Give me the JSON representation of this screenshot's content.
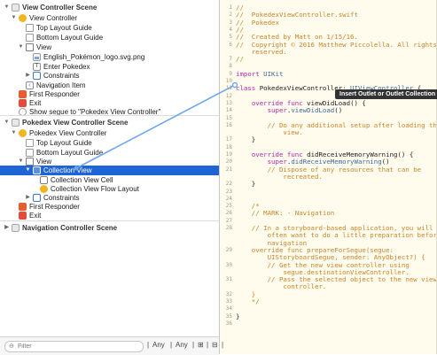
{
  "outline": {
    "items": [
      {
        "label": "View Controller Scene",
        "icon": "scene-icon",
        "level": 0,
        "tri": "▼",
        "kind": "hdr"
      },
      {
        "label": "View Controller",
        "icon": "view-controller-icon",
        "level": 1,
        "tri": "▼"
      },
      {
        "label": "Top Layout Guide",
        "icon": "layout-guide-icon",
        "level": 2,
        "tri": ""
      },
      {
        "label": "Bottom Layout Guide",
        "icon": "layout-guide-icon",
        "level": 2,
        "tri": ""
      },
      {
        "label": "View",
        "icon": "view-icon",
        "level": 2,
        "tri": "▼"
      },
      {
        "label": "English_Pokémon_logo.svg.png",
        "icon": "image-view-icon",
        "level": 3,
        "tri": ""
      },
      {
        "label": "Enter Pokedex",
        "icon": "text-field-icon",
        "level": 3,
        "tri": ""
      },
      {
        "label": "Constraints",
        "icon": "constraints-icon",
        "level": 3,
        "tri": "▶"
      },
      {
        "label": "Navigation Item",
        "icon": "navigation-item-icon",
        "level": 2,
        "tri": ""
      },
      {
        "label": "First Responder",
        "icon": "first-responder-icon",
        "level": 1,
        "tri": ""
      },
      {
        "label": "Exit",
        "icon": "exit-icon",
        "level": 1,
        "tri": ""
      },
      {
        "label": "Show segue to \"Pokedex View Controller\"",
        "icon": "segue-icon",
        "level": 1,
        "tri": ""
      },
      {
        "label": "Pokedex View Controller Scene",
        "icon": "scene-icon",
        "level": 0,
        "tri": "▼",
        "kind": "hdr"
      },
      {
        "label": "Pokedex View Controller",
        "icon": "view-controller-icon",
        "level": 1,
        "tri": "▼"
      },
      {
        "label": "Top Layout Guide",
        "icon": "layout-guide-icon",
        "level": 2,
        "tri": ""
      },
      {
        "label": "Bottom Layout Guide",
        "icon": "layout-guide-icon",
        "level": 2,
        "tri": ""
      },
      {
        "label": "View",
        "icon": "view-icon",
        "level": 2,
        "tri": "▼"
      },
      {
        "label": "Collection View",
        "icon": "collection-view-icon",
        "level": 3,
        "tri": "▼",
        "selected": true
      },
      {
        "label": "Collection View Cell",
        "icon": "collection-cell-icon",
        "level": 4,
        "tri": ""
      },
      {
        "label": "Collection View Flow Layout",
        "icon": "flow-layout-icon",
        "level": 4,
        "tri": ""
      },
      {
        "label": "Constraints",
        "icon": "constraints-icon",
        "level": 3,
        "tri": "▶"
      },
      {
        "label": "First Responder",
        "icon": "first-responder-icon",
        "level": 1,
        "tri": ""
      },
      {
        "label": "Exit",
        "icon": "exit-icon",
        "level": 1,
        "tri": ""
      },
      {
        "label": "Navigation Controller Scene",
        "icon": "scene-icon",
        "level": 0,
        "tri": "▶",
        "kind": "hdr"
      }
    ]
  },
  "filter": {
    "placeholder": "Filter",
    "value": ""
  },
  "bottom_tools": [
    "|",
    "Any",
    "|",
    "Any",
    "|",
    "⊞",
    "|",
    "⊟",
    "|"
  ],
  "editor": {
    "lines": [
      {
        "n": "1",
        "text": "//",
        "cls": "cmt"
      },
      {
        "n": "2",
        "text": "//  PokedexViewController.swift",
        "cls": "cmt"
      },
      {
        "n": "3",
        "text": "//  Pokedex",
        "cls": "cmt"
      },
      {
        "n": "4",
        "text": "//",
        "cls": "cmt"
      },
      {
        "n": "5",
        "text": "//  Created by Matt on 1/15/16.",
        "cls": "cmt"
      },
      {
        "n": "6",
        "text": "//  Copyright © 2016 Matthew Piccolella. All rights",
        "cls": "cmt"
      },
      {
        "n": "",
        "text": "    reserved.",
        "cls": "cmt"
      },
      {
        "n": "7",
        "text": "//",
        "cls": "cmt"
      },
      {
        "n": "8",
        "text": "",
        "cls": ""
      },
      {
        "n": "9",
        "text": "import UIKit",
        "cls": "kwline"
      },
      {
        "n": "10",
        "text": "",
        "cls": ""
      },
      {
        "n": "11",
        "text": "class PokedexViewController: UIViewController {",
        "cls": "classline"
      },
      {
        "n": "12",
        "text": "",
        "cls": ""
      },
      {
        "n": "13",
        "text": "    override func viewDidLoad() {",
        "cls": "funcline"
      },
      {
        "n": "14",
        "text": "        super.viewDidLoad()",
        "cls": "call"
      },
      {
        "n": "15",
        "text": "",
        "cls": ""
      },
      {
        "n": "16",
        "text": "        // Do any additional setup after loading the",
        "cls": "cmt"
      },
      {
        "n": "",
        "text": "            view.",
        "cls": "cmt"
      },
      {
        "n": "17",
        "text": "    }",
        "cls": ""
      },
      {
        "n": "18",
        "text": "",
        "cls": ""
      },
      {
        "n": "19",
        "text": "    override func didReceiveMemoryWarning() {",
        "cls": "funcline"
      },
      {
        "n": "20",
        "text": "        super.didReceiveMemoryWarning()",
        "cls": "call"
      },
      {
        "n": "21",
        "text": "        // Dispose of any resources that can be",
        "cls": "cmt"
      },
      {
        "n": "",
        "text": "            recreated.",
        "cls": "cmt"
      },
      {
        "n": "22",
        "text": "    }",
        "cls": ""
      },
      {
        "n": "23",
        "text": "",
        "cls": ""
      },
      {
        "n": "24",
        "text": "",
        "cls": ""
      },
      {
        "n": "25",
        "text": "    /*",
        "cls": "cmt"
      },
      {
        "n": "26",
        "text": "    // MARK: - Navigation",
        "cls": "cmt"
      },
      {
        "n": "27",
        "text": "",
        "cls": ""
      },
      {
        "n": "28",
        "text": "    // In a storyboard-based application, you will",
        "cls": "cmt"
      },
      {
        "n": "",
        "text": "        often want to do a little preparation before",
        "cls": "cmt"
      },
      {
        "n": "",
        "text": "        navigation",
        "cls": "cmt"
      },
      {
        "n": "29",
        "text": "    override func prepareForSegue(segue:",
        "cls": "cmt"
      },
      {
        "n": "",
        "text": "        UIStoryboardSegue, sender: AnyObject?) {",
        "cls": "cmt"
      },
      {
        "n": "30",
        "text": "        // Get the new view controller using",
        "cls": "cmt"
      },
      {
        "n": "",
        "text": "            segue.destinationViewController.",
        "cls": "cmt"
      },
      {
        "n": "31",
        "text": "        // Pass the selected object to the new view",
        "cls": "cmt"
      },
      {
        "n": "",
        "text": "            controller.",
        "cls": "cmt"
      },
      {
        "n": "32",
        "text": "    }",
        "cls": "cmt"
      },
      {
        "n": "33",
        "text": "    */",
        "cls": "cmt"
      },
      {
        "n": "34",
        "text": "",
        "cls": ""
      },
      {
        "n": "35",
        "text": "}",
        "cls": ""
      },
      {
        "n": "36",
        "text": "",
        "cls": ""
      }
    ],
    "tooltip": "Insert Outlet or Outlet Collection"
  }
}
